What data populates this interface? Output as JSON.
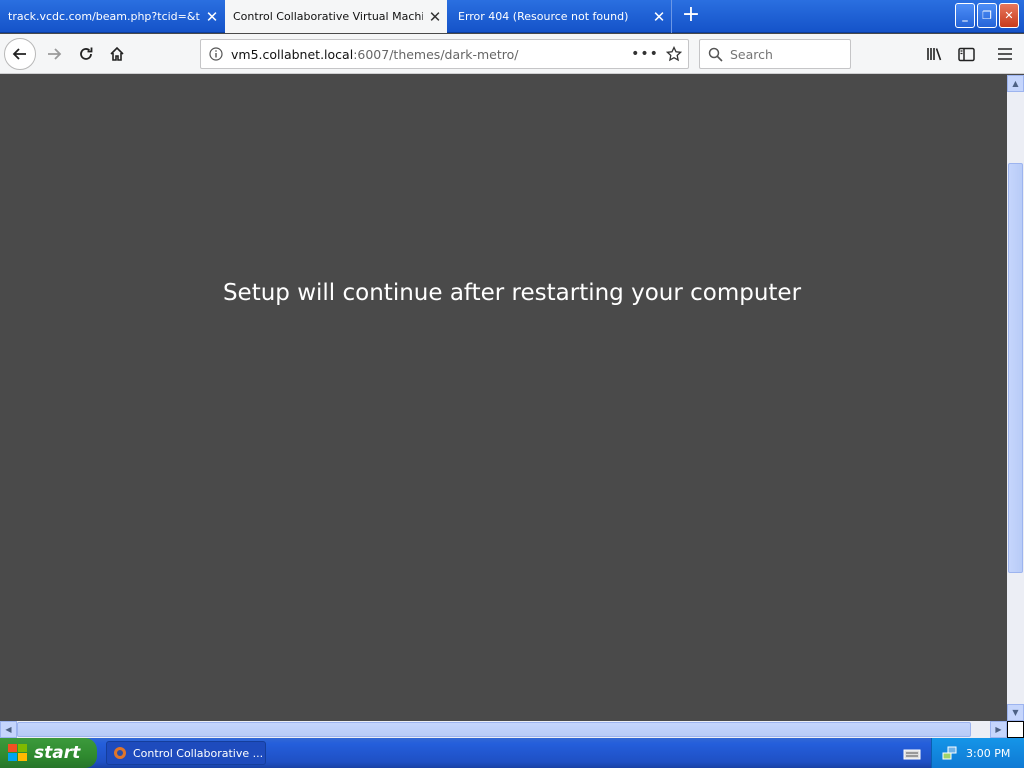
{
  "browser": {
    "tabs": [
      {
        "label": "track.vcdc.com/beam.php?tcid=&targ",
        "active": false
      },
      {
        "label": "Control Collaborative Virtual Machines!",
        "active": true
      },
      {
        "label": "Error 404 (Resource not found)",
        "active": false
      }
    ],
    "new_tab_icon": "plus-icon",
    "url_host": "vm5.collabnet.local",
    "url_rest": ":6007/themes/dark-metro/",
    "url_prefix": "",
    "search_placeholder": "Search"
  },
  "page": {
    "message": "Setup will continue after restarting your computer",
    "background": "#4a4a4a"
  },
  "taskbar": {
    "start_label": "start",
    "task_label": "Control Collaborative ...",
    "clock": "3:00 PM"
  },
  "colors": {
    "tabstrip": "#1553c9",
    "taskbar": "#245edb",
    "start_button": "#2f8a2f",
    "tray": "#0f7ad4"
  }
}
